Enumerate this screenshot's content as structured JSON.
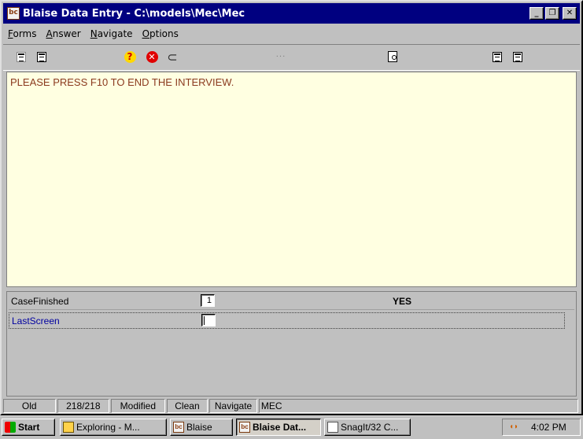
{
  "window": {
    "title": "Blaise Data Entry - C:\\models\\Mec\\Mec",
    "app_icon": "bc",
    "buttons": {
      "minimize": "_",
      "maximize": "❐",
      "close": "✕"
    }
  },
  "menu": [
    {
      "label": "Forms",
      "accel": "F",
      "rest": "orms"
    },
    {
      "label": "Answer",
      "accel": "A",
      "rest": "nswer"
    },
    {
      "label": "Navigate",
      "accel": "N",
      "rest": "avigate"
    },
    {
      "label": "Options",
      "accel": "O",
      "rest": "ptions"
    }
  ],
  "toolbar": {
    "icons": [
      "copy-form-icon",
      "form-icon",
      "help-icon",
      "stop-icon",
      "attach-icon",
      "dots-icon",
      "find-icon",
      "prev-form-icon",
      "next-form-icon"
    ],
    "dots": "···"
  },
  "info": {
    "message": "PLEASE PRESS F10 TO END THE INTERVIEW."
  },
  "form": {
    "rows": [
      {
        "field": "CaseFinished",
        "value": "1",
        "answer": "YES"
      },
      {
        "field": "LastScreen",
        "value": "",
        "answer": ""
      }
    ]
  },
  "status": [
    "Old",
    "218/218",
    "Modified",
    "Clean",
    "Navigate",
    "MEC"
  ],
  "taskbar": {
    "start": "Start",
    "buttons": [
      {
        "label": "Exploring - M...",
        "icon": "explorer-icon"
      },
      {
        "label": "Blaise",
        "icon": "blaise-icon"
      },
      {
        "label": "Blaise Dat...",
        "icon": "blaise-icon",
        "active": true
      },
      {
        "label": "SnagIt/32 C...",
        "icon": "snagit-icon"
      }
    ],
    "clock": "4:02 PM"
  },
  "colors": {
    "title_bg": "#000080",
    "info_bg": "#ffffe1",
    "info_text": "#8b3a1f",
    "field_link": "#0000a0"
  }
}
